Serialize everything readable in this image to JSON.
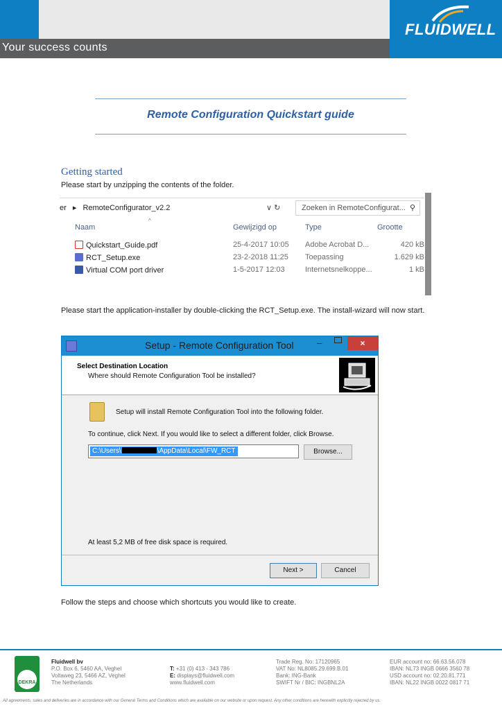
{
  "header": {
    "tagline": "Your success counts",
    "logo": "FLUIDWELL",
    "colors": {
      "brand_blue": "#0d7fc2",
      "strip_grey": "#5c5d5f"
    }
  },
  "title": "Remote Configuration Quickstart guide",
  "section_heading": "Getting started",
  "paragraphs": {
    "p1": "Please start by unzipping the contents of the folder.",
    "p2": "Please start the application-installer by double-clicking the RCT_Setup.exe. The install-wizard will now start.",
    "p3": "Follow the steps and choose which shortcuts you would like to create."
  },
  "explorer": {
    "path_prefix": "er",
    "path_sep": "▸",
    "path": "RemoteConfigurator_v2.2",
    "nav": "∨  ↻",
    "search_placeholder": "Zoeken in RemoteConfigurat...",
    "columns": [
      "Naam",
      "Gewijzigd op",
      "Type",
      "Grootte"
    ],
    "rows": [
      {
        "icon": "pdf-icon",
        "name": "Quickstart_Guide.pdf",
        "date": "25-4-2017 10:05",
        "type": "Adobe Acrobat D...",
        "size": "420 kB"
      },
      {
        "icon": "exe-icon",
        "name": "RCT_Setup.exe",
        "date": "23-2-2018 11:25",
        "type": "Toepassing",
        "size": "1.629 kB"
      },
      {
        "icon": "shortcut-icon",
        "name": "Virtual COM port driver",
        "date": "1-5-2017 12:03",
        "type": "Internetsnelkoppe...",
        "size": "1 kB"
      }
    ]
  },
  "dialog": {
    "title": "Setup - Remote Configuration Tool",
    "close_glyph": "×",
    "min_glyph": "–",
    "heading": "Select Destination Location",
    "subheading": "Where should Remote Configuration Tool be installed?",
    "text1": "Setup will install Remote Configuration Tool into the following folder.",
    "text2": "To continue, click Next. If you would like to select a different folder, click Browse.",
    "path_start": "C:\\Users\\",
    "path_end": "\\AppData\\Local\\FW_RCT",
    "browse_label": "Browse...",
    "space_text": "At least 5,2 MB of free disk space is required.",
    "next_label": "Next >",
    "cancel_label": "Cancel"
  },
  "footer": {
    "company": "Fluidwell bv",
    "address": [
      "P.O. Box 6, 5460 AA, Veghel",
      "Voltaweg 23, 5466 AZ, Veghel",
      "The Netherlands"
    ],
    "phone_label": "T:",
    "phone": "+31 (0) 413 - 343 786",
    "email_label": "E:",
    "email": "displays@fluidwell.com",
    "web": "www.fluidwell.com",
    "registry": [
      "Trade Reg. No: 17120965",
      "VAT No: NL8085.29.699.B.01",
      "Bank: ING-Bank",
      "SWIFT Nr / BIC: INGBNL2A"
    ],
    "accounts": [
      "EUR account no: 66.63.56.078",
      "IBAN: NL73 INGB 0666 3560 78",
      "USD account no: 02.20.81.771",
      "IBAN: NL22 INGB 0022 0817 71"
    ],
    "dekra_label": "DEKRA",
    "legal": "All agreements, sales and deliveries are in accordance with our General Terms and Conditions which are available on our website or upon request. Any other conditions are herewith explicitly rejected by us."
  }
}
